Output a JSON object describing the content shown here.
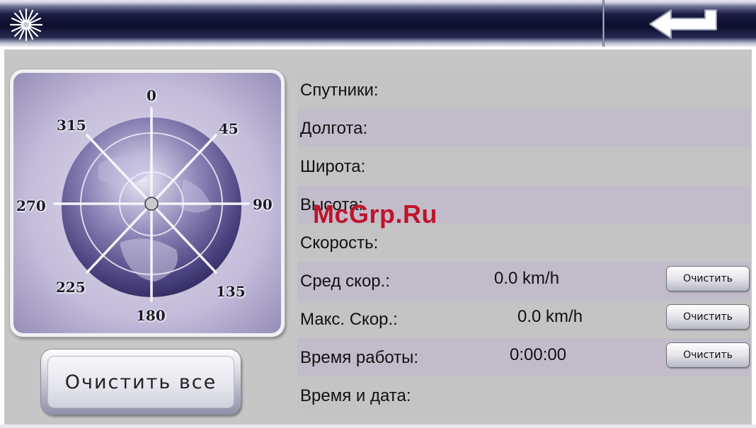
{
  "toolbar": {
    "left_icon": "sun-icon",
    "back_icon": "back-arrow-icon"
  },
  "compass": {
    "directions": [
      "0",
      "45",
      "90",
      "135",
      "180",
      "225",
      "270",
      "315"
    ]
  },
  "clear_all_label": "Очистить все",
  "rows": [
    {
      "label": "Спутники:",
      "value": "",
      "button": ""
    },
    {
      "label": "Долгота:",
      "value": "",
      "button": ""
    },
    {
      "label": "Широта:",
      "value": "",
      "button": ""
    },
    {
      "label": "Высота:",
      "value": "",
      "button": ""
    },
    {
      "label": "Скорость:",
      "value": "",
      "button": ""
    },
    {
      "label": "Сред скор.:",
      "value": "0.0 km/h",
      "button": "Очистить"
    },
    {
      "label": "Макс. Скор.:",
      "value": "0.0 km/h",
      "button": "Очистить"
    },
    {
      "label": "Время работы:",
      "value": "0:00:00",
      "button": "Очистить"
    },
    {
      "label": "Время и дата:",
      "value": "",
      "button": ""
    }
  ],
  "watermark": "McGrp.Ru"
}
